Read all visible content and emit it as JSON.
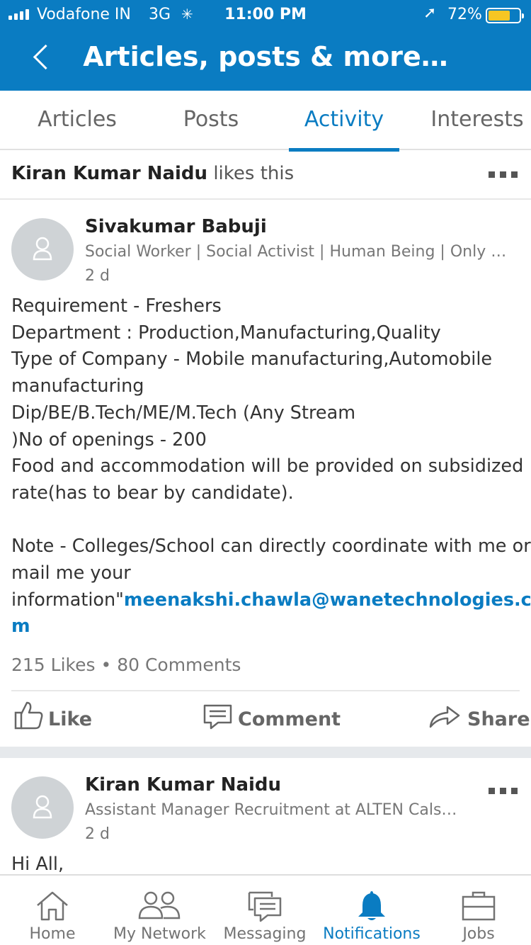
{
  "status_bar": {
    "carrier": "Vodafone IN",
    "network": "3G",
    "time": "11:00 PM",
    "battery": "72%",
    "battery_level": 0.72,
    "battery_color": "#f6c623"
  },
  "header": {
    "title": "Articles, posts & more…",
    "bg_color": "#0a7cc2",
    "back_icon": "chevron-left-icon"
  },
  "tabs": [
    {
      "label": "Articles",
      "active": false
    },
    {
      "label": "Posts",
      "active": false
    },
    {
      "label": "Activity",
      "active": true
    },
    {
      "label": "Interests",
      "active": false
    }
  ],
  "activity_header": {
    "actor": "Kiran Kumar Naidu",
    "action": "likes this"
  },
  "post1": {
    "author": "Sivakumar Babuji",
    "headline": "Social Worker | Social Activist | Human Being | Only Av…",
    "time": "2 d",
    "body_lines": [
      "Requirement - Freshers",
      "Department : Production,Manufacturing,Quality",
      "Type of Company - Mobile manufacturing,Automobile",
      "manufacturing",
      "Dip/BE/B.Tech/ME/M.Tech (Any Stream",
      ")No of openings - 200",
      "Food and accommodation will be provided on subsidized",
      "rate(has to bear by candidate).",
      "",
      "Note - Colleges/School can directly coordinate with me or",
      "mail me your"
    ],
    "body_last_prefix": "information\"",
    "body_link": "meenakshi.chawla@wanetechnologies.co",
    "body_link_cont": "m",
    "likes": "215 Likes",
    "dot": "•",
    "comments": "80 Comments",
    "actions": {
      "like": "Like",
      "comment": "Comment",
      "share": "Share"
    }
  },
  "post2": {
    "author": "Kiran Kumar Naidu",
    "headline": "Assistant Manager Recruitment at ALTEN Calso…",
    "time": "2 d",
    "body_first": "Hi All,"
  },
  "bottom_nav": [
    {
      "label": "Home",
      "icon": "home-icon",
      "active": false
    },
    {
      "label": "My Network",
      "icon": "network-icon",
      "active": false
    },
    {
      "label": "Messaging",
      "icon": "messaging-icon",
      "active": false
    },
    {
      "label": "Notifications",
      "icon": "bell-icon",
      "active": true
    },
    {
      "label": "Jobs",
      "icon": "briefcase-icon",
      "active": false
    }
  ]
}
